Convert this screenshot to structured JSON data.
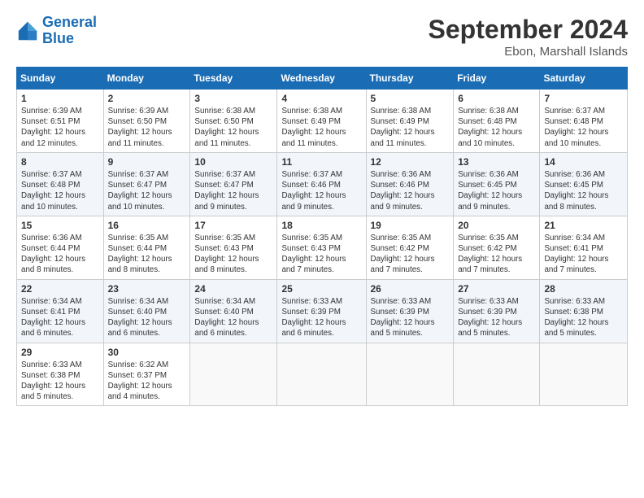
{
  "logo": {
    "line1": "General",
    "line2": "Blue"
  },
  "title": "September 2024",
  "location": "Ebon, Marshall Islands",
  "days_header": [
    "Sunday",
    "Monday",
    "Tuesday",
    "Wednesday",
    "Thursday",
    "Friday",
    "Saturday"
  ],
  "weeks": [
    [
      {
        "day": "1",
        "info": "Sunrise: 6:39 AM\nSunset: 6:51 PM\nDaylight: 12 hours\nand 12 minutes."
      },
      {
        "day": "2",
        "info": "Sunrise: 6:39 AM\nSunset: 6:50 PM\nDaylight: 12 hours\nand 11 minutes."
      },
      {
        "day": "3",
        "info": "Sunrise: 6:38 AM\nSunset: 6:50 PM\nDaylight: 12 hours\nand 11 minutes."
      },
      {
        "day": "4",
        "info": "Sunrise: 6:38 AM\nSunset: 6:49 PM\nDaylight: 12 hours\nand 11 minutes."
      },
      {
        "day": "5",
        "info": "Sunrise: 6:38 AM\nSunset: 6:49 PM\nDaylight: 12 hours\nand 11 minutes."
      },
      {
        "day": "6",
        "info": "Sunrise: 6:38 AM\nSunset: 6:48 PM\nDaylight: 12 hours\nand 10 minutes."
      },
      {
        "day": "7",
        "info": "Sunrise: 6:37 AM\nSunset: 6:48 PM\nDaylight: 12 hours\nand 10 minutes."
      }
    ],
    [
      {
        "day": "8",
        "info": "Sunrise: 6:37 AM\nSunset: 6:48 PM\nDaylight: 12 hours\nand 10 minutes."
      },
      {
        "day": "9",
        "info": "Sunrise: 6:37 AM\nSunset: 6:47 PM\nDaylight: 12 hours\nand 10 minutes."
      },
      {
        "day": "10",
        "info": "Sunrise: 6:37 AM\nSunset: 6:47 PM\nDaylight: 12 hours\nand 9 minutes."
      },
      {
        "day": "11",
        "info": "Sunrise: 6:37 AM\nSunset: 6:46 PM\nDaylight: 12 hours\nand 9 minutes."
      },
      {
        "day": "12",
        "info": "Sunrise: 6:36 AM\nSunset: 6:46 PM\nDaylight: 12 hours\nand 9 minutes."
      },
      {
        "day": "13",
        "info": "Sunrise: 6:36 AM\nSunset: 6:45 PM\nDaylight: 12 hours\nand 9 minutes."
      },
      {
        "day": "14",
        "info": "Sunrise: 6:36 AM\nSunset: 6:45 PM\nDaylight: 12 hours\nand 8 minutes."
      }
    ],
    [
      {
        "day": "15",
        "info": "Sunrise: 6:36 AM\nSunset: 6:44 PM\nDaylight: 12 hours\nand 8 minutes."
      },
      {
        "day": "16",
        "info": "Sunrise: 6:35 AM\nSunset: 6:44 PM\nDaylight: 12 hours\nand 8 minutes."
      },
      {
        "day": "17",
        "info": "Sunrise: 6:35 AM\nSunset: 6:43 PM\nDaylight: 12 hours\nand 8 minutes."
      },
      {
        "day": "18",
        "info": "Sunrise: 6:35 AM\nSunset: 6:43 PM\nDaylight: 12 hours\nand 7 minutes."
      },
      {
        "day": "19",
        "info": "Sunrise: 6:35 AM\nSunset: 6:42 PM\nDaylight: 12 hours\nand 7 minutes."
      },
      {
        "day": "20",
        "info": "Sunrise: 6:35 AM\nSunset: 6:42 PM\nDaylight: 12 hours\nand 7 minutes."
      },
      {
        "day": "21",
        "info": "Sunrise: 6:34 AM\nSunset: 6:41 PM\nDaylight: 12 hours\nand 7 minutes."
      }
    ],
    [
      {
        "day": "22",
        "info": "Sunrise: 6:34 AM\nSunset: 6:41 PM\nDaylight: 12 hours\nand 6 minutes."
      },
      {
        "day": "23",
        "info": "Sunrise: 6:34 AM\nSunset: 6:40 PM\nDaylight: 12 hours\nand 6 minutes."
      },
      {
        "day": "24",
        "info": "Sunrise: 6:34 AM\nSunset: 6:40 PM\nDaylight: 12 hours\nand 6 minutes."
      },
      {
        "day": "25",
        "info": "Sunrise: 6:33 AM\nSunset: 6:39 PM\nDaylight: 12 hours\nand 6 minutes."
      },
      {
        "day": "26",
        "info": "Sunrise: 6:33 AM\nSunset: 6:39 PM\nDaylight: 12 hours\nand 5 minutes."
      },
      {
        "day": "27",
        "info": "Sunrise: 6:33 AM\nSunset: 6:39 PM\nDaylight: 12 hours\nand 5 minutes."
      },
      {
        "day": "28",
        "info": "Sunrise: 6:33 AM\nSunset: 6:38 PM\nDaylight: 12 hours\nand 5 minutes."
      }
    ],
    [
      {
        "day": "29",
        "info": "Sunrise: 6:33 AM\nSunset: 6:38 PM\nDaylight: 12 hours\nand 5 minutes."
      },
      {
        "day": "30",
        "info": "Sunrise: 6:32 AM\nSunset: 6:37 PM\nDaylight: 12 hours\nand 4 minutes."
      },
      {
        "day": "",
        "info": ""
      },
      {
        "day": "",
        "info": ""
      },
      {
        "day": "",
        "info": ""
      },
      {
        "day": "",
        "info": ""
      },
      {
        "day": "",
        "info": ""
      }
    ]
  ]
}
